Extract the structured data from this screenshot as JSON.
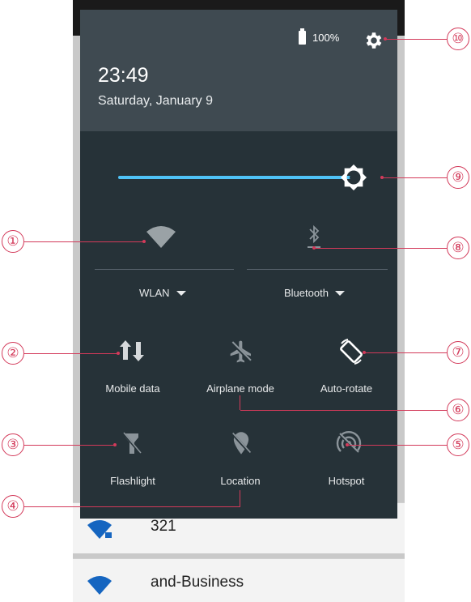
{
  "status": {
    "battery": "100%"
  },
  "header": {
    "time": "23:49",
    "date": "Saturday, January 9"
  },
  "brightness": {
    "level": 0.95
  },
  "connections": [
    {
      "label": "WLAN",
      "icon": "wifi-icon"
    },
    {
      "label": "Bluetooth",
      "icon": "bluetooth-icon"
    }
  ],
  "tiles": [
    {
      "label": "Mobile data",
      "icon": "mobile-data-icon"
    },
    {
      "label": "Airplane mode",
      "icon": "airplane-icon"
    },
    {
      "label": "Auto-rotate",
      "icon": "auto-rotate-icon"
    },
    {
      "label": "Flashlight",
      "icon": "flashlight-icon"
    },
    {
      "label": "Location",
      "icon": "location-off-icon"
    },
    {
      "label": "Hotspot",
      "icon": "hotspot-off-icon"
    }
  ],
  "behind_list": [
    {
      "name": "321",
      "icon": "wifi-locked-icon"
    },
    {
      "name": "and-Business",
      "icon": "wifi-icon"
    }
  ],
  "callouts": [
    "①",
    "②",
    "③",
    "④",
    "⑤",
    "⑥",
    "⑦",
    "⑧",
    "⑨",
    "⑩"
  ],
  "colors": {
    "panel": "#263238",
    "header": "#3f4a51",
    "accent": "#4fc3f7",
    "callout": "#d33a5a"
  }
}
